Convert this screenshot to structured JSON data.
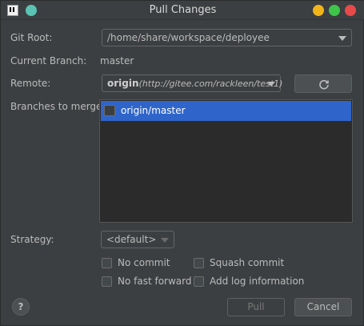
{
  "window": {
    "title": "Pull Changes"
  },
  "git_root": {
    "label": "Git Root:",
    "value": "/home/share/workspace/deployee"
  },
  "current_branch": {
    "label": "Current Branch:",
    "value": "master"
  },
  "remote": {
    "label": "Remote:",
    "name": "origin",
    "url": "(http://gitee.com/rackleen/test1)"
  },
  "branches": {
    "label": "Branches to merge:",
    "items": [
      {
        "label": "origin/master",
        "checked": false,
        "selected": true
      }
    ]
  },
  "strategy": {
    "label": "Strategy:",
    "value": "<default>"
  },
  "options": [
    {
      "label": "No commit",
      "checked": false
    },
    {
      "label": "Squash commit",
      "checked": false
    },
    {
      "label": "No fast forward",
      "checked": false
    },
    {
      "label": "Add log information",
      "checked": false
    }
  ],
  "buttons": {
    "help": "?",
    "pull": "Pull",
    "cancel": "Cancel"
  },
  "colors": {
    "background": "#3c3f41",
    "selection": "#2f65ca",
    "list_background": "#2b2b2b"
  }
}
